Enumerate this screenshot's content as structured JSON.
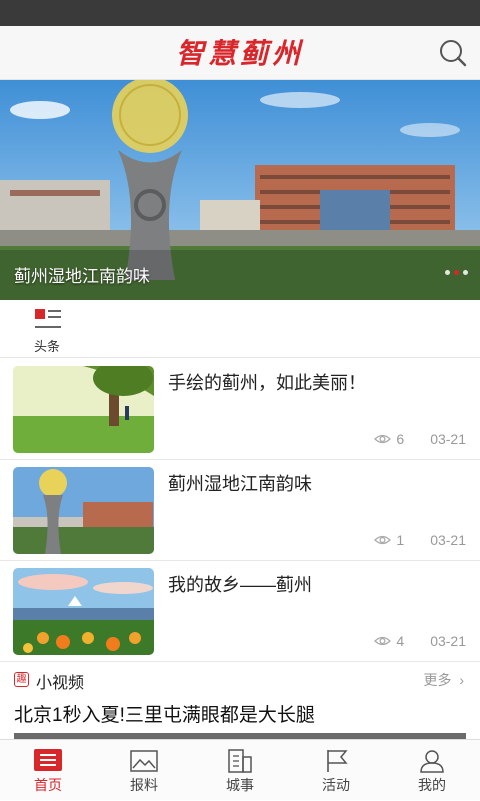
{
  "header": {
    "logo_text": "智慧蓟州",
    "search_icon": "search-icon",
    "accent": "#d9262b"
  },
  "banner": {
    "caption": "蓟州湿地江南韵味",
    "dots": [
      false,
      true,
      false
    ]
  },
  "section_tab": {
    "label": "头条",
    "icon": "headline-icon"
  },
  "news": [
    {
      "title": "手绘的蓟州，如此美丽！",
      "views": "6",
      "date": "03-21",
      "thumb": "tree-park"
    },
    {
      "title": "蓟州湿地江南韵味",
      "views": "1",
      "date": "03-21",
      "thumb": "sculpture-plaza"
    },
    {
      "title": "我的故乡——蓟州",
      "views": "4",
      "date": "03-21",
      "thumb": "flower-shore"
    }
  ],
  "video_section": {
    "badge": "趣",
    "title": "小视频",
    "more_label": "更多",
    "first_title": "北京1秒入夏!三里屯满眼都是大长腿"
  },
  "bottom_nav": [
    {
      "label": "首页",
      "icon": "home-icon",
      "active": true
    },
    {
      "label": "报料",
      "icon": "image-report-icon",
      "active": false
    },
    {
      "label": "城事",
      "icon": "city-news-icon",
      "active": false
    },
    {
      "label": "活动",
      "icon": "flag-icon",
      "active": false
    },
    {
      "label": "我的",
      "icon": "user-icon",
      "active": false
    }
  ]
}
